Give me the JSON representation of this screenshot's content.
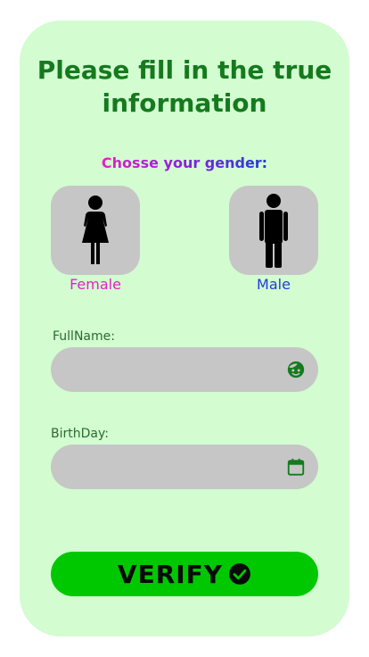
{
  "form": {
    "title": "Please fill in the true information",
    "gender_prompt": "Chosse your gender:",
    "gender_options": [
      {
        "label": "Female",
        "icon": "female-figure-icon",
        "color": "#e81fc6"
      },
      {
        "label": "Male",
        "icon": "male-figure-icon",
        "color": "#1f3fd6"
      }
    ],
    "fullname": {
      "label": "FullName:",
      "value": "",
      "icon": "face-icon"
    },
    "birthday": {
      "label": "BirthDay:",
      "value": "",
      "icon": "calendar-icon"
    },
    "verify_label": "VERIFY",
    "verify_icon": "check-circle-icon"
  },
  "colors": {
    "card_bg": "#d3fcd1",
    "title": "#157a1e",
    "field_bg": "#c6c6c6",
    "button_bg": "#00c800",
    "icon_green": "#157a1e"
  }
}
